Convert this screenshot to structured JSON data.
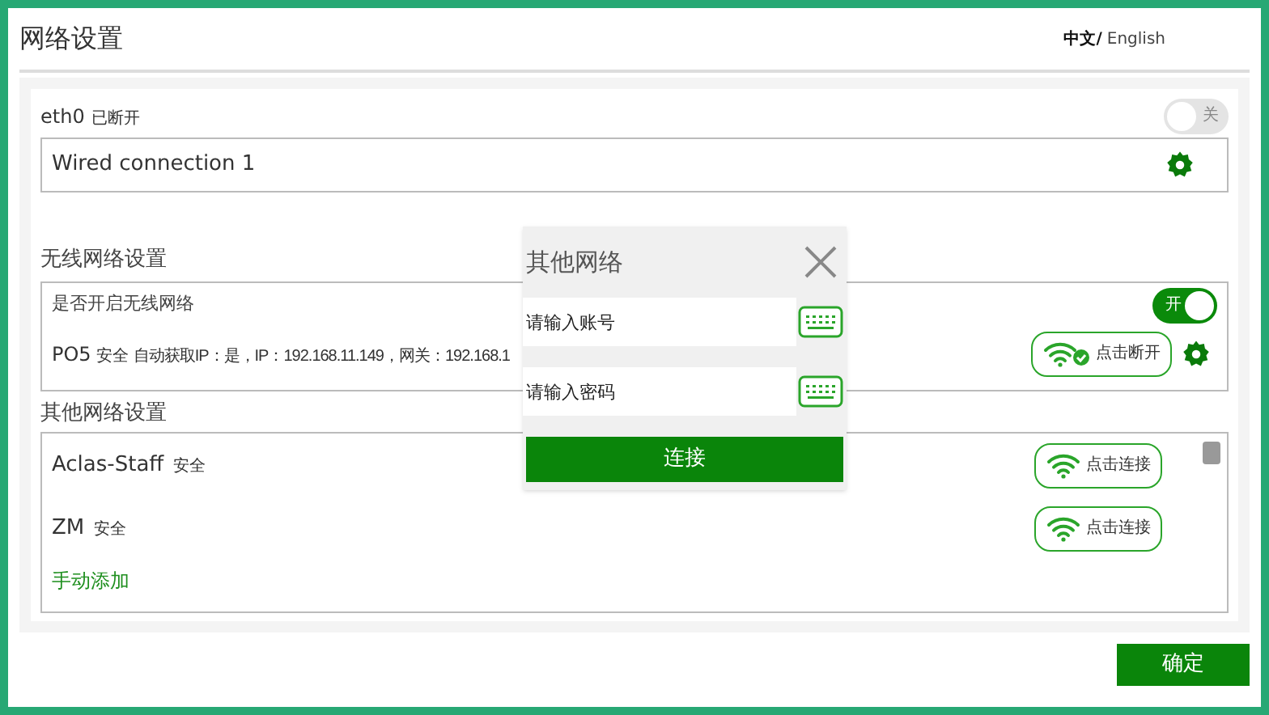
{
  "window": {
    "title": "网络设置"
  },
  "language": [
    {
      "label": "中文/",
      "selected": true
    },
    {
      "label": "English",
      "selected": false
    }
  ],
  "wired": {
    "name": "eth0",
    "status": "已断开",
    "toggle": {
      "on": false,
      "label": "关"
    },
    "connection": "Wired connection 1"
  },
  "wireless": {
    "heading": "无线网络设置",
    "enable_label": "是否开启无线网络",
    "toggle": {
      "on": true,
      "label": "开"
    },
    "current": {
      "ssid": "PO5",
      "security": "安全",
      "details": "自动获取IP：是，IP：192.168.11.149，网关：192.168.1",
      "action": "点击断开",
      "connected": true
    }
  },
  "other": {
    "heading": "其他网络设置",
    "networks": [
      {
        "ssid": "Aclas-Staff",
        "security": "安全",
        "action": "点击连接",
        "connected": false
      },
      {
        "ssid": "ZM",
        "security": "安全",
        "action": "点击连接",
        "connected": false
      }
    ],
    "add_link": "手动添加"
  },
  "dialog": {
    "title": "其他网络",
    "fields": [
      {
        "placeholder": "请输入账号"
      },
      {
        "placeholder": "请输入密码"
      }
    ],
    "connect_button": "连接"
  },
  "confirm_button": "确定"
}
